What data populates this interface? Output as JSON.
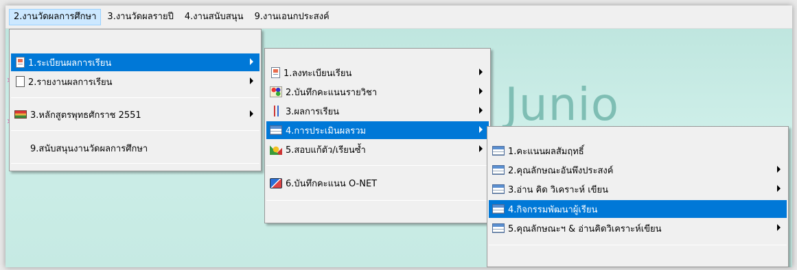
{
  "menubar": {
    "items": [
      {
        "label": "2.งานวัดผลการศึกษา"
      },
      {
        "label": "3.งานวัดผลรายปี"
      },
      {
        "label": "4.งานสนับสนุน"
      },
      {
        "label": "9.งานเอนกประสงค์"
      }
    ]
  },
  "background": {
    "banner_text": "s’2551 Junio"
  },
  "menu1": {
    "items": [
      {
        "label": "1.ระเบียนผลการเรียน",
        "icon": "document-icon"
      },
      {
        "label": "2.รายงานผลการเรียน",
        "icon": "page-icon"
      },
      {
        "label": "3.หลักสูตรพุทธศักราช 2551",
        "icon": "books-icon"
      },
      {
        "label": "9.สนับสนุนงานวัดผลการศึกษา"
      }
    ]
  },
  "menu2": {
    "items": [
      {
        "label": "1.ลงทะเบียนเรียน",
        "icon": "document-icon"
      },
      {
        "label": "2.บันทึกคะแนนรายวิชา",
        "icon": "score-icon"
      },
      {
        "label": "3.ผลการเรียน",
        "icon": "result-icon"
      },
      {
        "label": "4.การประเมินผลรวม",
        "icon": "table-icon"
      },
      {
        "label": "5.สอบแก้ตัว/เรียนซ้ำ",
        "icon": "exam-icon"
      },
      {
        "label": "6.บันทึกคะแนน O-NET",
        "icon": "onet-icon"
      }
    ]
  },
  "menu3": {
    "items": [
      {
        "label": "1.คะแนนผลสัมฤทธิ์",
        "icon": "table-icon"
      },
      {
        "label": "2.คุณลักษณะอันพึงประสงค์",
        "icon": "table-icon"
      },
      {
        "label": "3.อ่าน คิด วิเคราะห์ เขียน",
        "icon": "table-icon"
      },
      {
        "label": "4.กิจกรรมพัฒนาผู้เรียน",
        "icon": "table-icon"
      },
      {
        "label": "5.คุณลักษณะฯ & อ่านคิดวิเคราะห์เขียน",
        "icon": "table-icon"
      }
    ]
  },
  "colors": {
    "highlight": "#0078d7",
    "menubar_active": "#cce8ff",
    "menu_bg": "#f0f0f0",
    "app_bg": "#c6eae3"
  }
}
